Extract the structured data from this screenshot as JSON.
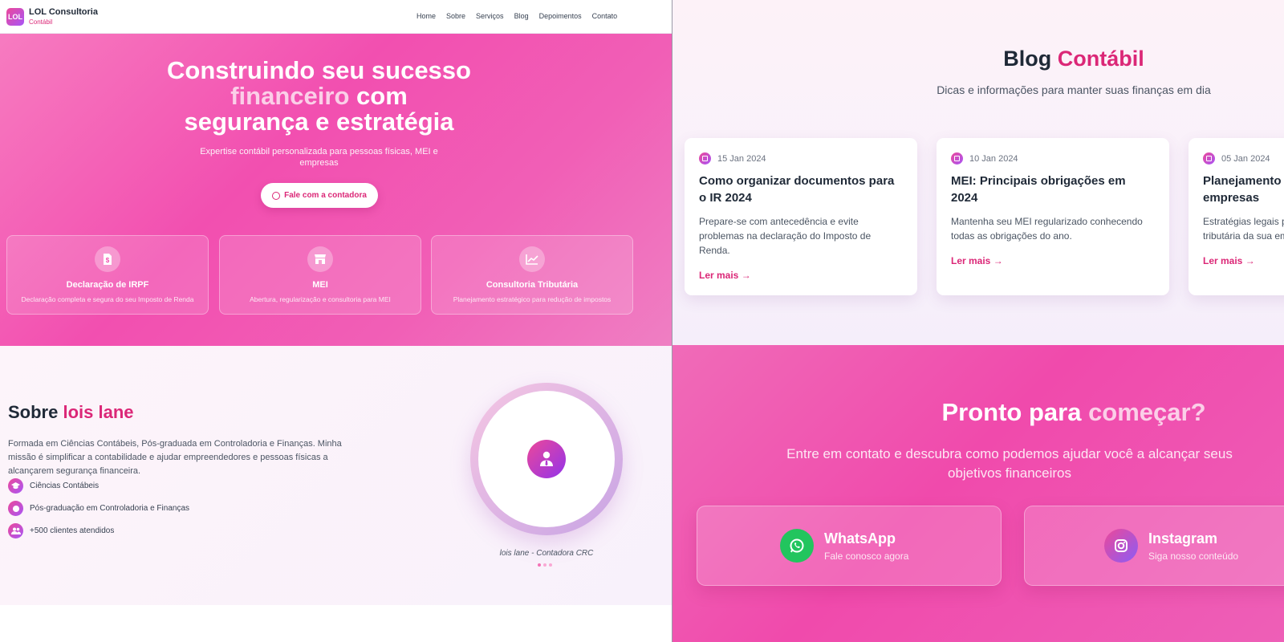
{
  "nav": {
    "logo_text": "LOL",
    "brand_name": "LOL Consultoria",
    "brand_sub": "Contábil",
    "links": [
      "Home",
      "Sobre",
      "Serviços",
      "Blog",
      "Depoimentos",
      "Contato"
    ]
  },
  "hero": {
    "title_line1": "Construindo seu sucesso",
    "title_highlight": "financeiro",
    "title_line2_rest": "com",
    "title_line3": "segurança e estratégia",
    "subtitle": "Expertise contábil personalizada para pessoas físicas, MEI e empresas",
    "cta_label": "Fale com a contadora",
    "services": [
      {
        "icon": "document-dollar-icon",
        "title": "Declaração de IRPF",
        "desc": "Declaração completa e segura do seu Imposto de Renda"
      },
      {
        "icon": "store-icon",
        "title": "MEI",
        "desc": "Abertura, regularização e consultoria para MEI"
      },
      {
        "icon": "chart-line-icon",
        "title": "Consultoria Tributária",
        "desc": "Planejamento estratégico para redução de impostos"
      }
    ]
  },
  "about": {
    "title_prefix": "Sobre",
    "title_name": "lois lane",
    "text": "Formada em Ciências Contábeis, Pós-graduada em Controladoria e Finanças. Minha missão é simplificar a contabilidade e ajudar empreendedores e pessoas físicas a alcançarem segurança financeira.",
    "features": [
      {
        "icon": "graduation-cap-icon",
        "label": "Ciências Contábeis"
      },
      {
        "icon": "certificate-icon",
        "label": "Pós-graduação em Controladoria e Finanças"
      },
      {
        "icon": "users-icon",
        "label": "+500 clientes atendidos"
      }
    ],
    "caption": "lois lane - Contadora CRC"
  },
  "blog": {
    "title_prefix": "Blog",
    "title_highlight": "Contábil",
    "subtitle": "Dicas e informações para manter suas finanças em dia",
    "read_more": "Ler mais",
    "posts": [
      {
        "date": "15 Jan 2024",
        "title": "Como organizar documentos para o IR 2024",
        "excerpt": "Prepare-se com antecedência e evite problemas na declaração do Imposto de Renda."
      },
      {
        "date": "10 Jan 2024",
        "title": "MEI: Principais obrigações em 2024",
        "excerpt": "Mantenha seu MEI regularizado conhecendo todas as obrigações do ano."
      },
      {
        "date": "05 Jan 2024",
        "title": "Planejamento tributário para empresas",
        "excerpt": "Estratégias legais para redução da carga tributária da sua empresa."
      }
    ]
  },
  "cta": {
    "title_prefix": "Pronto para",
    "title_highlight": "começar?",
    "subtitle": "Entre em contato e descubra como podemos ajudar você a alcançar seus objetivos financeiros",
    "whatsapp_title": "WhatsApp",
    "whatsapp_sub": "Fale conosco agora",
    "instagram_title": "Instagram",
    "instagram_sub": "Siga nosso conteúdo"
  },
  "colors": {
    "brand_pink": "#db2777",
    "hero_pink": "#f24fb0",
    "whatsapp_green": "#22c55e",
    "instagram_purple": "#a855f7"
  }
}
